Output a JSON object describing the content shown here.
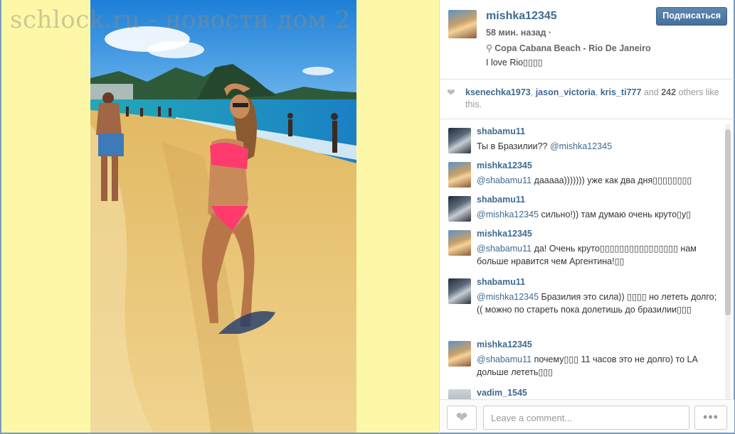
{
  "watermark": "schlock.ru - новости дом 2",
  "post": {
    "username": "mishka12345",
    "follow_label": "Подписаться",
    "time_label": "58 мин. назад ·",
    "location": "Copa Cabana Beach - Rio De Janeiro",
    "caption": "I love Rio▯▯▯▯"
  },
  "likes": {
    "users": [
      "ksenechka1973",
      "jason_victoria",
      "kris_ti777"
    ],
    "sep1": ", ",
    "sep2": ", ",
    "and_word": " and ",
    "count": "242",
    "suffix": " others like this."
  },
  "comments": [
    {
      "user": "shabamu11",
      "avatar": "dark",
      "pre": "Ты в Бразилии?? ",
      "mention": "@mishka12345",
      "post": ""
    },
    {
      "user": "mishka12345",
      "avatar": "girl",
      "pre": "",
      "mention": "@shabamu11",
      "post": " дааааа))))))) уже как два дня▯▯▯▯▯▯▯▯"
    },
    {
      "user": "shabamu11",
      "avatar": "dark",
      "pre": "",
      "mention": "@mishka12345",
      "post": " сильно!)) там думаю очень круто▯у▯"
    },
    {
      "user": "mishka12345",
      "avatar": "girl",
      "pre": "",
      "mention": "@shabamu11",
      "post": " да! Очень круто▯▯▯▯▯▯▯▯▯▯▯▯▯▯▯▯ нам больше нравится чем Аргентина!▯▯"
    },
    {
      "user": "shabamu11",
      "avatar": "dark",
      "pre": "",
      "mention": "@mishka12345",
      "post": " Бразилия это сила)) ▯▯▯▯ но лететь долго;(( можно по стареть пока долетишь до бразилии▯▯▯"
    },
    {
      "user": "mishka12345",
      "avatar": "girl",
      "pre": "",
      "mention": "@shabamu11",
      "post": " почему▯▯▯ 11 часов это не долго) то LA дольше лететь▯▯▯"
    },
    {
      "user": "vadim_1545",
      "avatar": "grey",
      "pre": "",
      "mention": "",
      "post": ""
    }
  ],
  "comment_box": {
    "placeholder": "Leave a comment..."
  },
  "more_label": "•••",
  "icons": {
    "like": "heart-icon",
    "location": "map-pin-icon",
    "more": "more-dots-icon"
  },
  "colors": {
    "link": "#3f6a92",
    "follow": "#4f79a4",
    "background_left": "#fdf8a8"
  }
}
